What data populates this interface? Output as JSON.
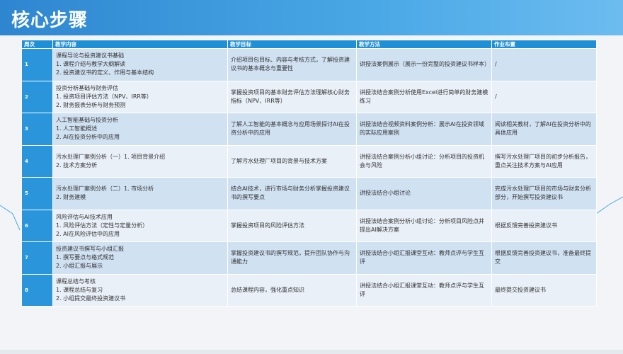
{
  "title": "核心步骤",
  "colors": {
    "header": "#2e86d0",
    "th": "#1f8fd6",
    "num": "#2b95dc",
    "row_dark": "#d0e1f2",
    "row_light": "#e9f0f8"
  },
  "table": {
    "headers": [
      "周次",
      "教学内容",
      "教学目标",
      "教学方法",
      "作业布置"
    ],
    "rows": [
      {
        "week": "1",
        "content": "课程导论与投资建议书基础\n1. 课程介绍与教学大纲解读\n2. 投资建议书的定义、作用与基本结构",
        "goal": "介绍项目包目标、内容与考核方式，了解投资建议书的基本概念与重要性",
        "method": "讲授法案例展示（展示一份完整的投资建议书样本）",
        "homework": "/"
      },
      {
        "week": "2",
        "content": "投资分析基础与财务评估\n1. 投资项目评估方法（NPV、IRR等）\n2. 财务报表分析与财务预测",
        "goal": "掌握投资项目的基本财务评估方法理解核心财务指标（NPV、IRR等）",
        "method": "讲授法结合案例分析使用Excel进行简单的财务建模练习",
        "homework": "/"
      },
      {
        "week": "3",
        "content": "人工智能基础与投资分析\n1. 人工智能概述\n2. AI在投资分析中的应用",
        "goal": "了解人工智能的基本概念与应用场景探讨AI在投资分析中的应用",
        "method": "讲授法结合视频资料案例分析：展示AI在投资领域的实际应用案例",
        "homework": "阅读相关教材，了解AI在投资分析中的具体应用"
      },
      {
        "week": "4",
        "content": "污水处理厂案例分析（一）1. 项目背景介绍\n2. 技术方案分析",
        "goal": "了解污水处理厂项目的背景与技术方案",
        "method": "讲授法结合案例分析小组讨论：分析项目的投资机会与风险",
        "homework": "撰写污水处理厂项目的初步分析报告，重点关注技术方案与AI应用"
      },
      {
        "week": "5",
        "content": "污水处理厂案例分析（二）1. 市场分析\n2. 财务建模",
        "goal": "结合AI技术，进行市场与财务分析掌握投资建议书的撰写要点",
        "method": "讲授法结合小组讨论",
        "homework": "完成污水处理厂项目的市场与财务分析部分，开始撰写投资建议书"
      },
      {
        "week": "6",
        "content": "风险评估与AI技术应用\n1. 风险评估方法（定性与定量分析）\n2. AI在风险评估中的应用",
        "goal": "掌握投资项目的风险评估方法",
        "method": "讲授法结合案例分析小组讨论：分析项目风险点并提出AI解决方案",
        "homework": "根据反馈完善投资建议书"
      },
      {
        "week": "7",
        "content": "投资建议书撰写与小组汇报\n1. 撰写要点与格式规范\n2. 小组汇报与展示",
        "goal": "掌握投资建议书的撰写规范，提升团队协作与沟通能力",
        "method": "讲授法结合小组汇报课堂互动：教师点评与学生互评",
        "homework": "根据反馈完善投资建议书，准备最终提交"
      },
      {
        "week": "8",
        "content": "课程总结与考核\n1. 课程总结与复习\n2. 小组提交最终投资建议书",
        "goal": "总结课程内容，强化重点知识",
        "method": "讲授法结合小组汇报课堂互动：教师点评与学生互评",
        "homework": "最终提交投资建议书"
      }
    ]
  }
}
